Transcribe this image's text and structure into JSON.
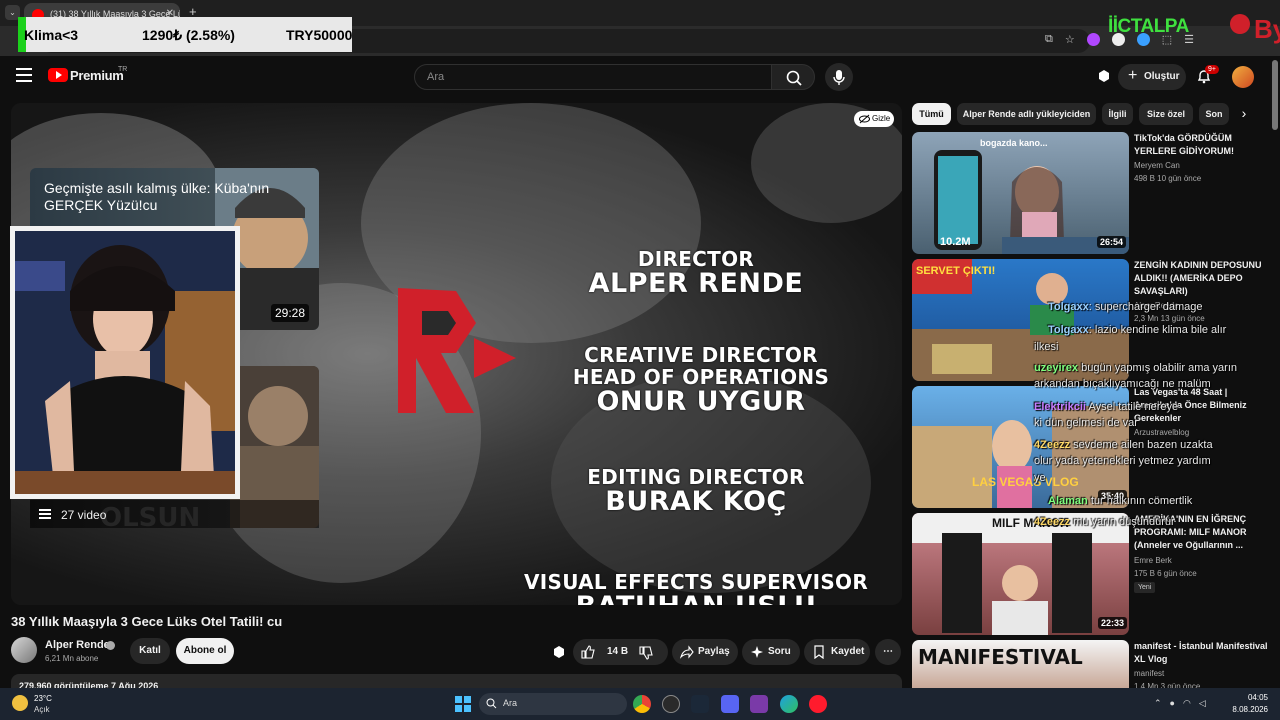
{
  "browser": {
    "tab_title": "(31) 38 Yıllık Maaşıyla 3 Gece Lü",
    "tab_icon": "youtube-icon",
    "new_tab": "+",
    "tab_close": "✕"
  },
  "overlay": {
    "ticker_left": "Klima<3",
    "ticker_mid": "1290₺ (2.58%)",
    "ticker_right": "TRY50000",
    "streamer_logo": "İİCTALPA",
    "corner_logo": "By"
  },
  "masthead": {
    "logo_text": "Premium",
    "logo_sup": "TR",
    "search_placeholder": "Ara",
    "create_label": "Oluştur",
    "notifications_badge": "9+"
  },
  "player": {
    "hide_label": "Gizle",
    "credits": [
      {
        "role": "DIRECTOR",
        "name": "ALPER RENDE"
      },
      {
        "role": "CREATIVE DIRECTOR",
        "role2": "HEAD OF OPERATIONS",
        "name": "ONUR UYGUR"
      },
      {
        "role": "EDITING DIRECTOR",
        "name": "BURAK KOÇ"
      },
      {
        "role": "VISUAL EFFECTS SUPERVISOR",
        "name": "BATUHAN USLU"
      }
    ],
    "endcard1": {
      "title": "Geçmişte asılı kalmış ülke: Küba'nın GERÇEK Yüzü!",
      "suffix": "cu",
      "duration": "29:28"
    },
    "endcard2": {
      "playlist_count": "27 video"
    },
    "brand_mark": "RND"
  },
  "video": {
    "title": "38 Yıllık Maaşıyla 3 Gece Lüks Otel Tatili! cu",
    "channel": "Alper Rende",
    "subscribers": "6,21 Mn abone",
    "join_label": "Katıl",
    "subscribe_label": "Abone ol",
    "likes": "14 B",
    "share_label": "Paylaş",
    "ask_label": "Soru",
    "save_label": "Kaydet",
    "views_line": "279.960 görüntüleme  7 Ağu 2026"
  },
  "chips": [
    "Tümü",
    "Alper Rende adlı yükleyiciden",
    "İlgili",
    "Size özel",
    "Son"
  ],
  "recommendations": [
    {
      "title": "TikTok'da GÖRDÜĞÜM YERLERE GİDİYORUM!",
      "channel": "Meryem Can",
      "meta": "498 B   10 gün önce",
      "duration": "26:54",
      "thumb_text": "bogazda kano...",
      "thumb_badge": "10.2M"
    },
    {
      "title": "ZENGİN KADININ DEPOSUNU ALDIK!! (AMERİKA DEPO SAVAŞLARI)",
      "channel": "Alper Rende",
      "meta": "2,3 Mn   13 gün önce",
      "duration": "",
      "thumb_text": "SERVET ÇIKTI!"
    },
    {
      "title": "Las Vegas'ta 48 Saat | Amerika'da Önce Bilmeniz Gerekenler",
      "channel": "Arzustravelblog",
      "meta": "",
      "duration": "35:40",
      "thumb_text": "LAS VEGAS VLOG"
    },
    {
      "title": "AMERİKA'NIN EN İĞRENÇ PROGRAMI: MILF MANOR (Anneler ve Oğullarının ...",
      "channel": "Emre Berk",
      "meta": "175 B   6 gün önce",
      "duration": "22:33",
      "badge": "Yeni",
      "thumb_text": "MILF MANOR"
    },
    {
      "title": "manifest - İstanbul Manifestival XL Vlog",
      "channel": "manifest",
      "meta": "1,4 Mn   3 gün önce",
      "duration": "",
      "thumb_text": "MANIFESTIVAL"
    }
  ],
  "chat": [
    {
      "user": "Tolgaxx",
      "text": "supercharger damage",
      "user_color": "#9ad0ff"
    },
    {
      "user": "Tolgaxx",
      "text": "lazio kendine klima bile alır",
      "user_color": "#9ad0ff"
    },
    {
      "user": "",
      "text": "ilkesi",
      "user_color": "#ffffff"
    },
    {
      "user": "uzeyirex",
      "text": "bugün yapmış olabilir ama yarın",
      "user_color": "#7fff7f"
    },
    {
      "user": "",
      "text": "arkandan bıçaklıyamıcağı ne malüm",
      "user_color": "#ffffff"
    },
    {
      "user": "Elektrikcii",
      "text": "Aysel tatile nereye",
      "user_color": "#c77dff"
    },
    {
      "user": "",
      "text": "ki dün gelmesi de var",
      "user_color": "#ffffff"
    },
    {
      "user": "4Zeezz",
      "text": "sevdeme ailen bazen uzakta",
      "user_color": "#ffd966"
    },
    {
      "user": "",
      "text": "olur yada yetenekleri yetmez yardım",
      "user_color": "#ffffff"
    },
    {
      "user": "",
      "text": "ye",
      "user_color": "#ffffff"
    },
    {
      "user": "Alaman",
      "text": "tur halkının cömertlik",
      "user_color": "#7fff7f"
    },
    {
      "user": "4Zeezz",
      "text": "mu yarın düşündürür",
      "user_color": "#ffd966"
    }
  ],
  "taskbar": {
    "temp": "23°C",
    "weather": "Açık",
    "search": "Ara",
    "time": "04:05",
    "date": "8.08.2026"
  },
  "colors": {
    "yt_red": "#ff0000",
    "ticker_green": "#1bd11b",
    "brand_red": "#d0202a",
    "background": "#0f0f0f"
  }
}
